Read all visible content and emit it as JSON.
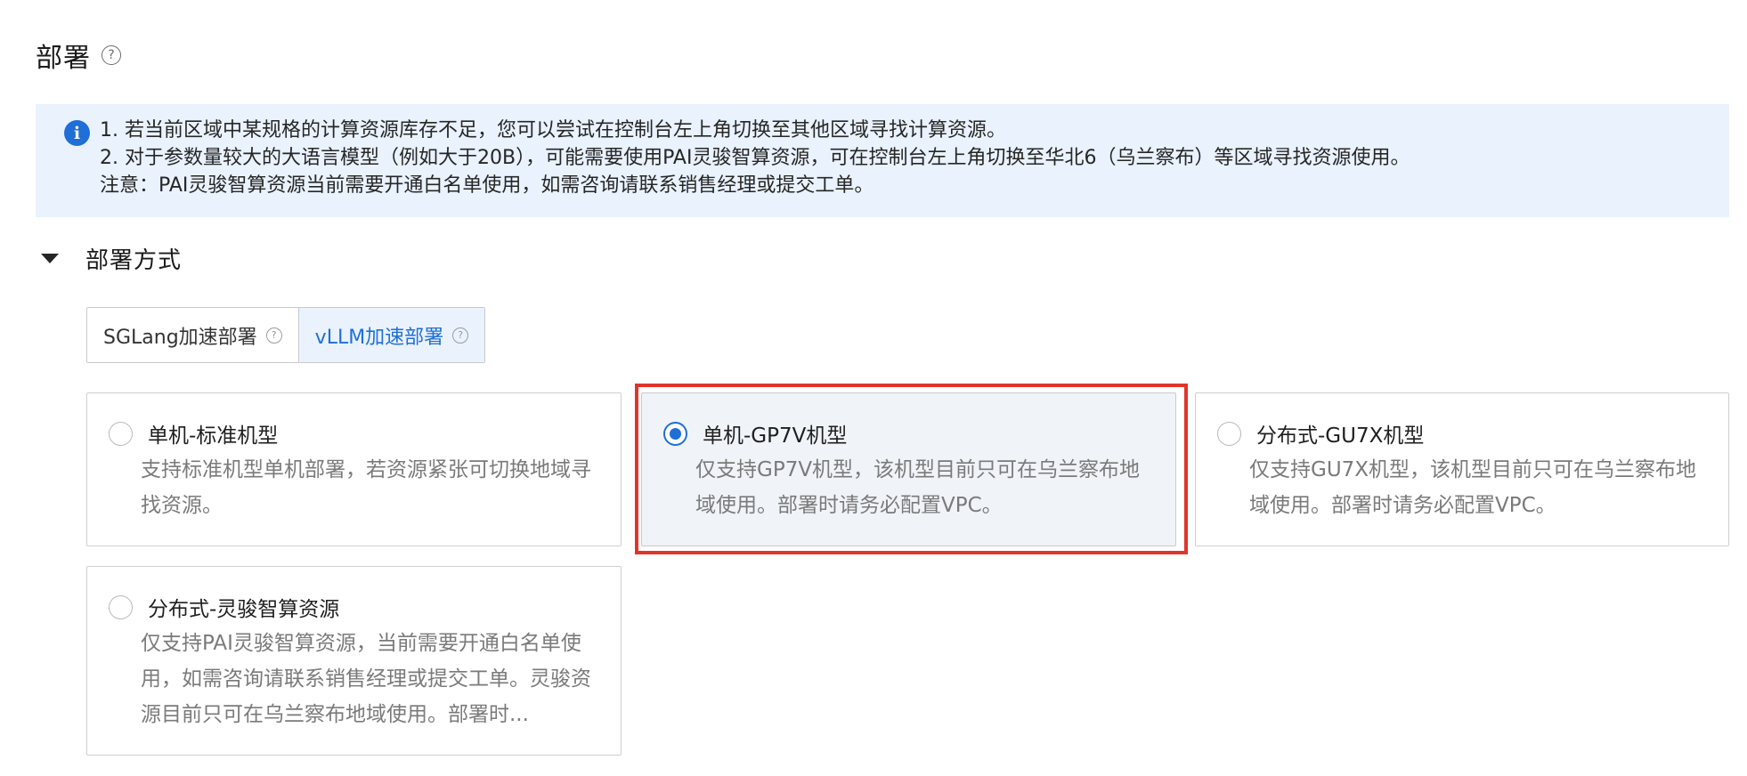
{
  "header": {
    "title": "部署",
    "help_icon": "help-circle-icon"
  },
  "info_banner": {
    "icon": "info-circle-icon",
    "lines": [
      "1. 若当前区域中某规格的计算资源库存不足，您可以尝试在控制台左上角切换至其他区域寻找计算资源。",
      "2. 对于参数量较大的大语言模型（例如大于20B），可能需要使用PAI灵骏智算资源，可在控制台左上角切换至华北6（乌兰察布）等区域寻找资源使用。",
      "注意：PAI灵骏智算资源当前需要开通白名单使用，如需咨询请联系销售经理或提交工单。"
    ]
  },
  "deploy_method": {
    "title": "部署方式",
    "caret_icon": "caret-down-icon",
    "tabs": [
      {
        "label": "SGLang加速部署",
        "active": false
      },
      {
        "label": "vLLM加速部署",
        "active": true
      }
    ],
    "options": [
      {
        "title": "单机-标准机型",
        "desc": "支持标准机型单机部署，若资源紧张可切换地域寻找资源。",
        "selected": false
      },
      {
        "title": "单机-GP7V机型",
        "desc": "仅支持GP7V机型，该机型目前只可在乌兰察布地域使用。部署时请务必配置VPC。",
        "selected": true
      },
      {
        "title": "分布式-GU7X机型",
        "desc": "仅支持GU7X机型，该机型目前只可在乌兰察布地域使用。部署时请务必配置VPC。",
        "selected": false
      },
      {
        "title": "分布式-灵骏智算资源",
        "desc": "仅支持PAI灵骏智算资源，当前需要开通白名单使用，如需咨询请联系销售经理或提交工单。灵骏资源目前只可在乌兰察布地域使用。部署时...",
        "selected": false
      }
    ]
  },
  "colors": {
    "accent": "#1f6fd6",
    "banner_bg": "#e9f2fd",
    "highlight": "#e0352b"
  }
}
